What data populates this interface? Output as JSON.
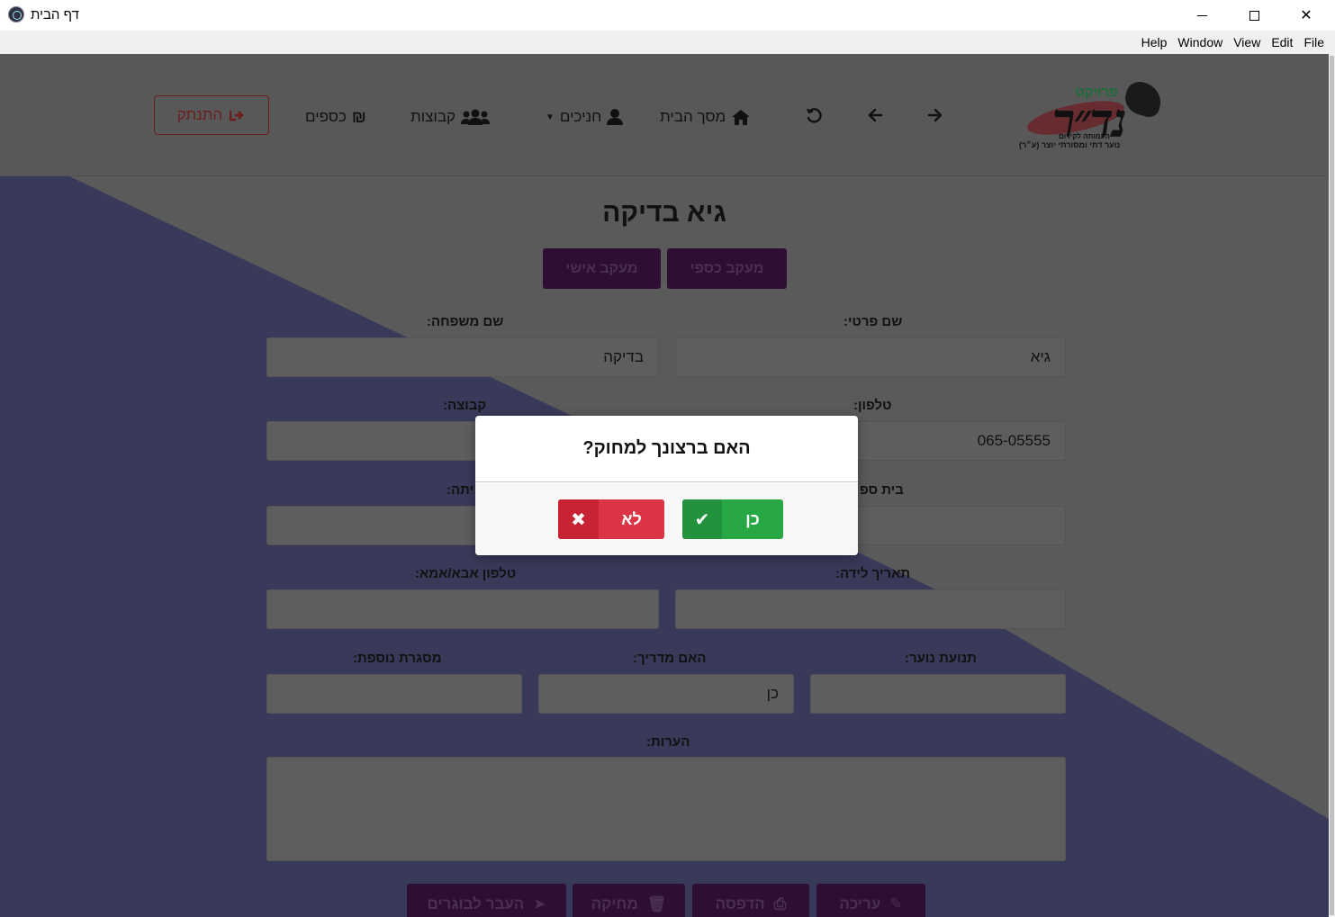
{
  "window": {
    "title": "דף הבית",
    "minimize_glyph": "",
    "maximize_glyph": "",
    "close_glyph": "✕"
  },
  "menu": [
    "File",
    "Edit",
    "View",
    "Window",
    "Help"
  ],
  "logo": {
    "top": "פרויקט",
    "main": "נד״ר",
    "sub": "העמותה לקידום",
    "tag": "נוער דתי ומסורתי יוצר (ע״ר)"
  },
  "nav": {
    "forward_icon": "arrow-right-icon",
    "back_icon": "arrow-left-icon",
    "refresh_icon": "undo-icon",
    "home_label": "מסך הבית",
    "students_label": "חניכים",
    "groups_label": "קבוצות",
    "money_label": "כספים",
    "logout_label": "התנתק"
  },
  "page": {
    "title": "גיא בדיקה",
    "tabs": [
      "מעקב כספי",
      "מעקב אישי"
    ]
  },
  "form": {
    "first_name_label": "שם פרטי:",
    "first_name_value": "גיא",
    "last_name_label": "שם משפחה:",
    "last_name_value": "בדיקה",
    "phone_label": "טלפון:",
    "phone_value": "065-05555",
    "group_label": "קבוצה:",
    "group_value": "",
    "school_label": "בית ספ",
    "grade_label": "יתה:",
    "birthdate_label": "תאריך לידה:",
    "parent_phone_label": "טלפון אבא/אמא:",
    "youth_movement_label": "תנועת נוער:",
    "is_counselor_label": "האם מדריך:",
    "is_counselor_value": "כן",
    "extra_framework_label": "מסגרת נוספת:",
    "notes_label": "הערות:"
  },
  "actions": {
    "edit_label": "עריכה",
    "print_label": "הדפסה",
    "delete_label": "מחיקה",
    "transfer_label": "העבר לבוגרים"
  },
  "modal": {
    "question": "האם ברצונך למחוק?",
    "yes_label": "כן",
    "no_label": "לא",
    "yes_icon_glyph": "✔",
    "no_icon_glyph": "✖"
  },
  "colors": {
    "yes": "#28a745",
    "no": "#dc3545",
    "tab_bg": "#2e0f33",
    "logout_border": "#6b1d1d"
  }
}
